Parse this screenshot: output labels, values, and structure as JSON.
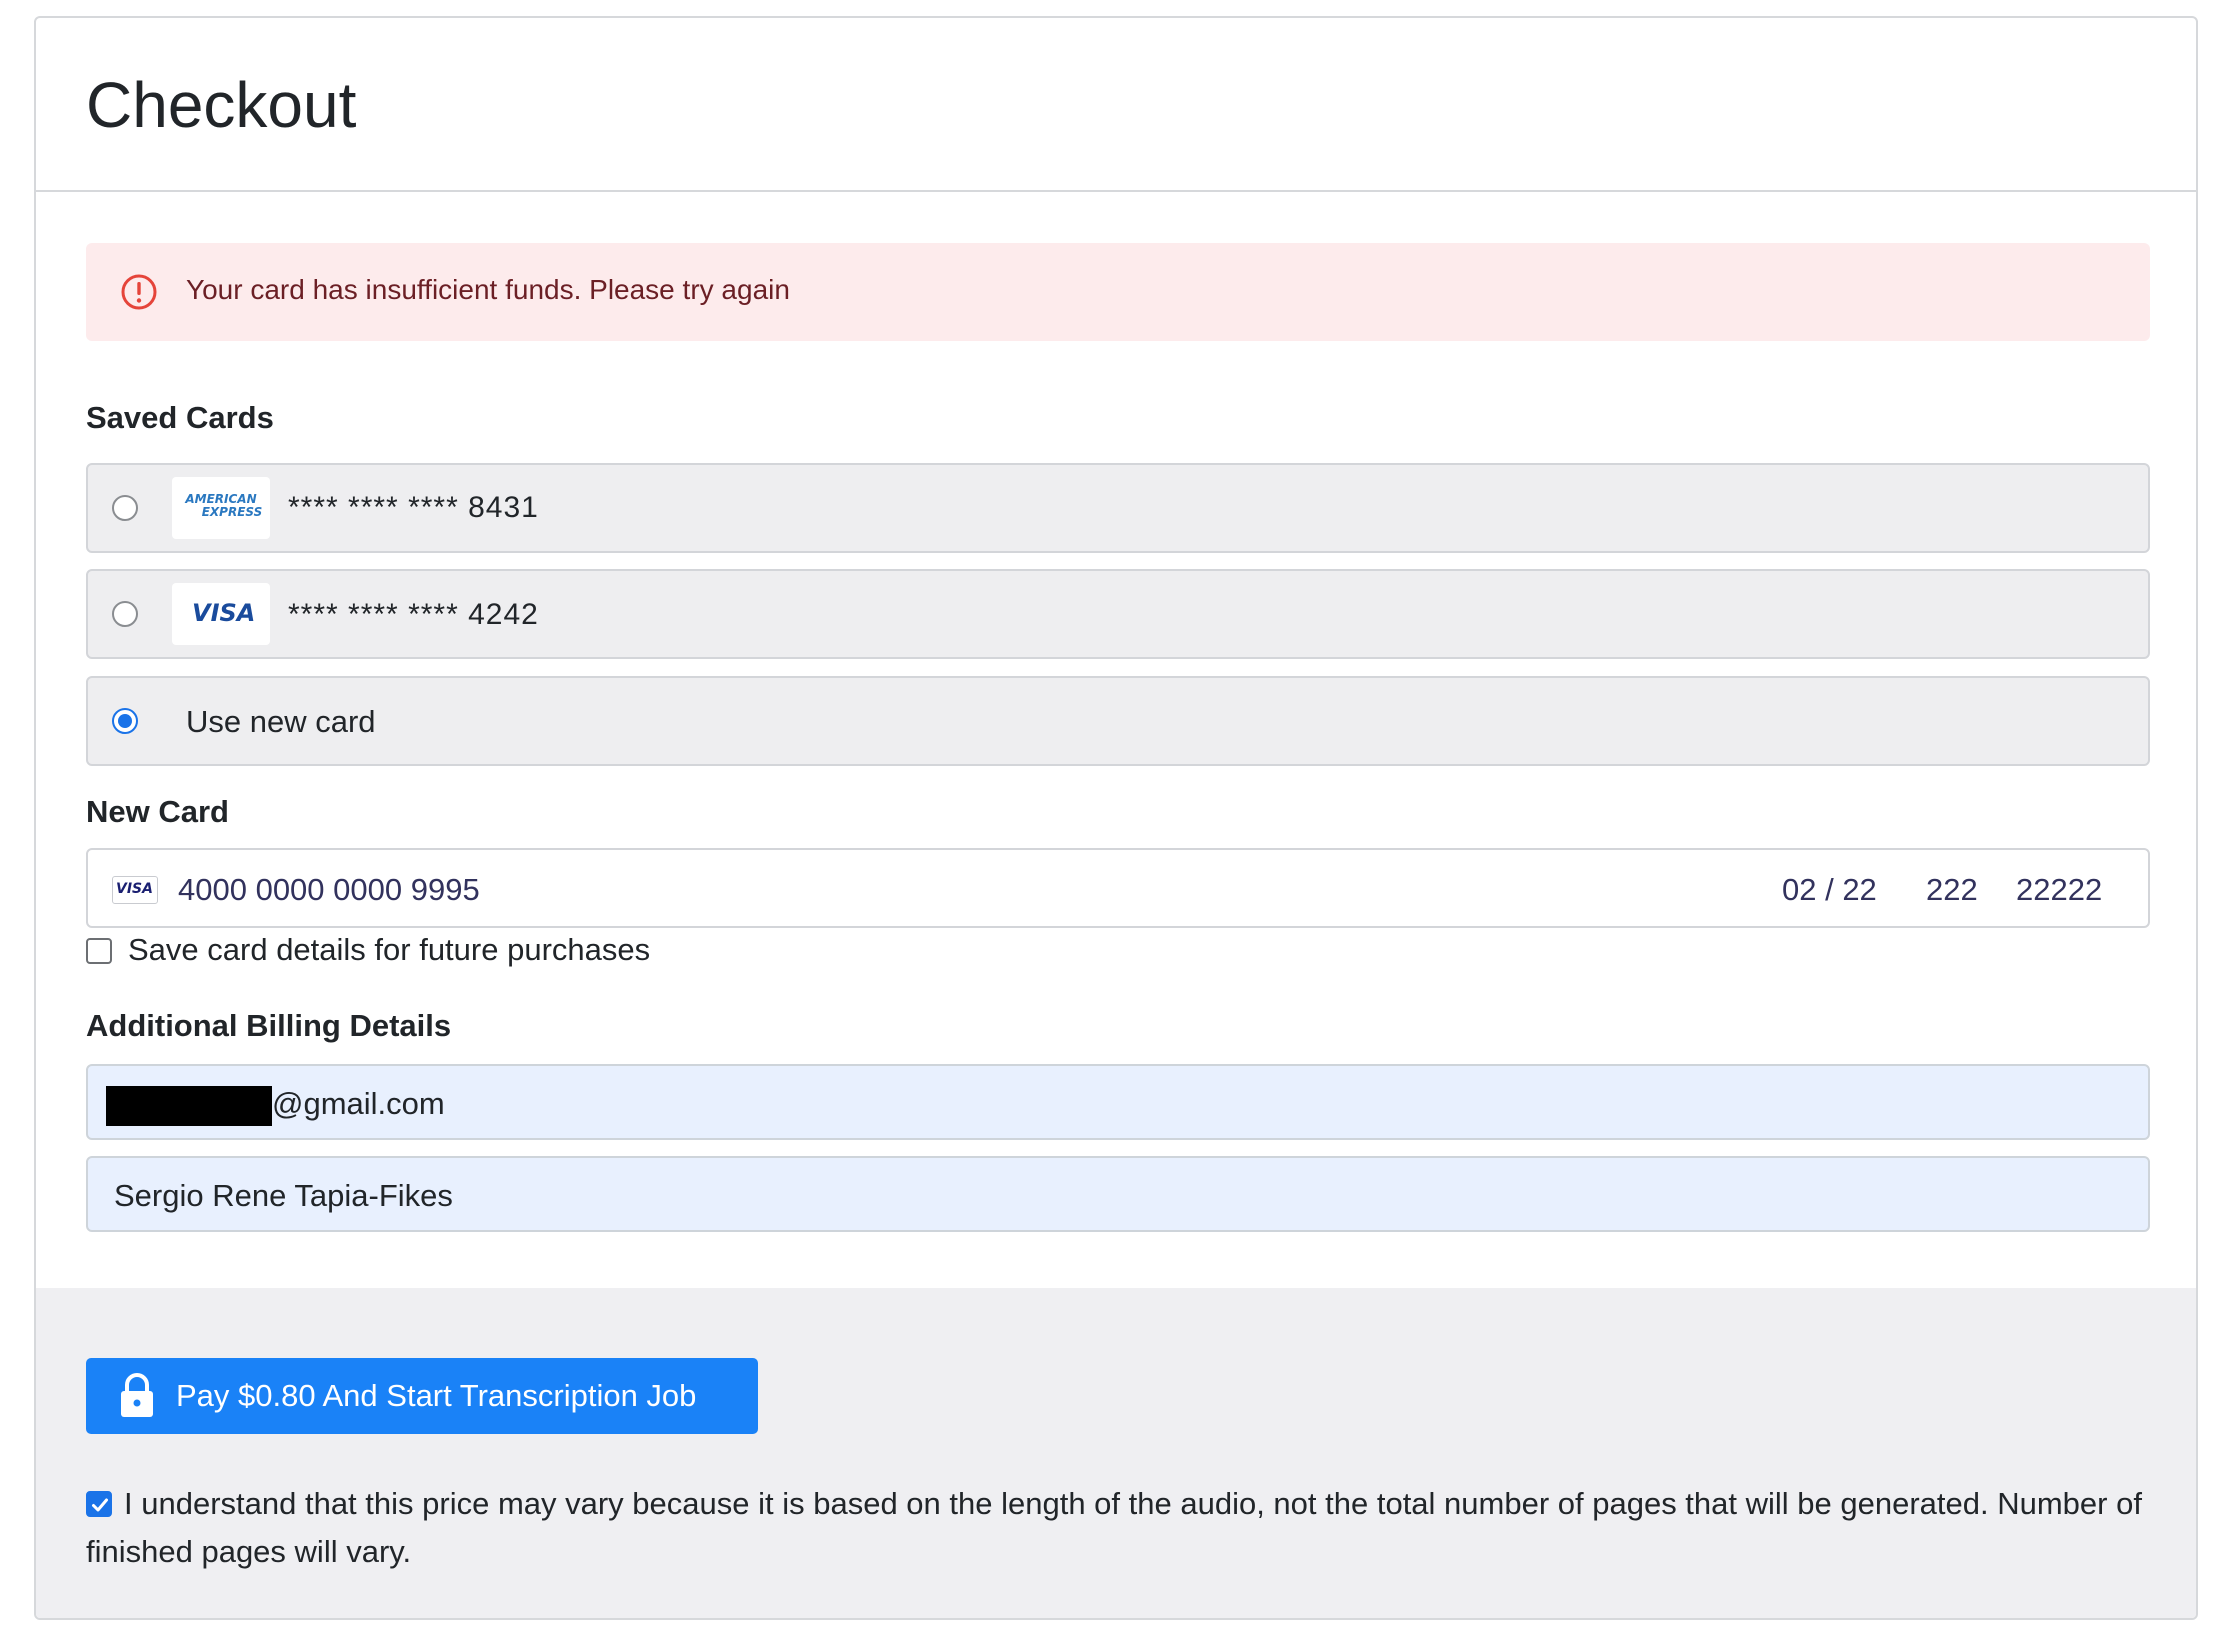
{
  "header": {
    "title": "Checkout"
  },
  "alert": {
    "message": "Your card has insufficient funds. Please try again",
    "icon": "alert-circle-icon",
    "color": "#e5443a"
  },
  "saved_cards": {
    "label": "Saved Cards",
    "items": [
      {
        "brand": "AMERICAN EXPRESS",
        "brand_line1": "AMERICAN",
        "brand_line2": "EXPRESS",
        "mask": "**** **** ****",
        "last4": "8431",
        "selected": false
      },
      {
        "brand": "VISA",
        "mask": "**** **** ****",
        "last4": "4242",
        "selected": false
      }
    ],
    "new_card_option": {
      "label": "Use new card",
      "selected": true
    }
  },
  "new_card": {
    "label": "New Card",
    "brand": "VISA",
    "number": "4000 0000 0000 9995",
    "expiry": "02 / 22",
    "cvc": "222",
    "zip": "22222",
    "save_label": "Save card details for future purchases",
    "save_checked": false
  },
  "billing": {
    "label": "Additional Billing Details",
    "email_suffix": "@gmail.com",
    "name": "Sergio Rene Tapia-Fikes"
  },
  "footer": {
    "pay_label": "Pay $0.80 And Start Transcription Job",
    "understand_text": "I understand that this price may vary because it is based on the length of the audio, not the total number of pages that will be generated. Number of finished pages will vary.",
    "understand_checked": true
  },
  "colors": {
    "accent": "#1a82f7",
    "alert_bg": "#fdebec",
    "field_bg": "#e8f0fe"
  }
}
